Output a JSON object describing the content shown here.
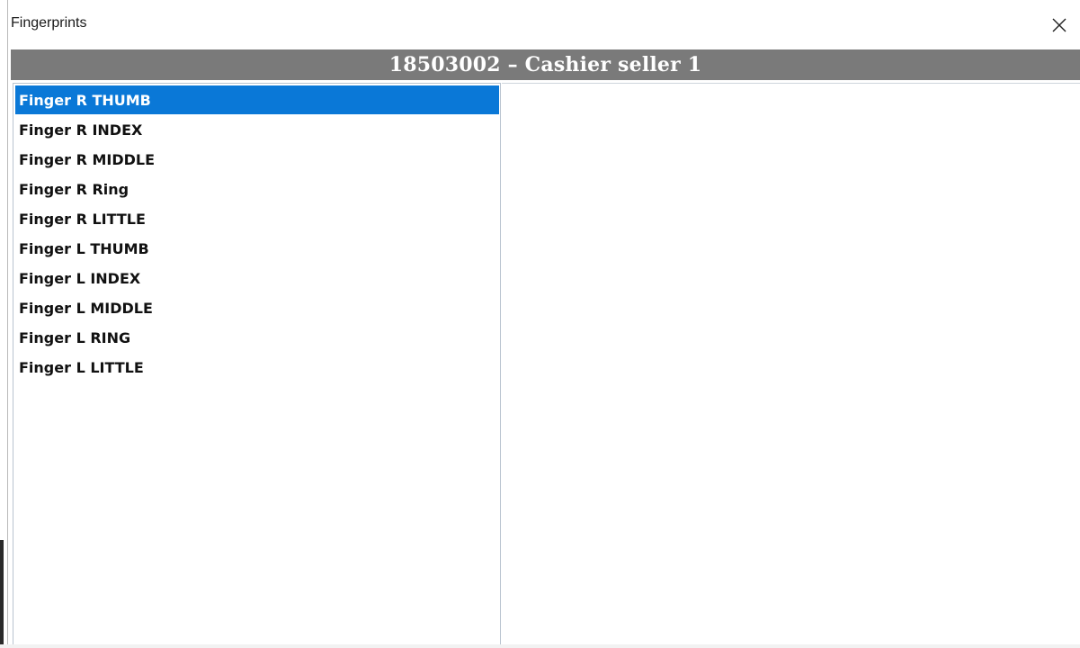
{
  "window": {
    "title": "Fingerprints",
    "close_icon": "close-icon"
  },
  "header": {
    "text": "18503002 – Cashier seller 1"
  },
  "fingers": [
    {
      "label": "Finger R THUMB",
      "selected": true
    },
    {
      "label": "Finger R INDEX",
      "selected": false
    },
    {
      "label": "Finger R MIDDLE",
      "selected": false
    },
    {
      "label": "Finger R Ring",
      "selected": false
    },
    {
      "label": "Finger R LITTLE",
      "selected": false
    },
    {
      "label": "Finger L THUMB",
      "selected": false
    },
    {
      "label": "Finger L INDEX",
      "selected": false
    },
    {
      "label": "Finger L MIDDLE",
      "selected": false
    },
    {
      "label": "Finger L RING",
      "selected": false
    },
    {
      "label": "Finger L LITTLE",
      "selected": false
    }
  ],
  "colors": {
    "selection": "#0a78d7",
    "header_bar": "#7a7a7a"
  }
}
